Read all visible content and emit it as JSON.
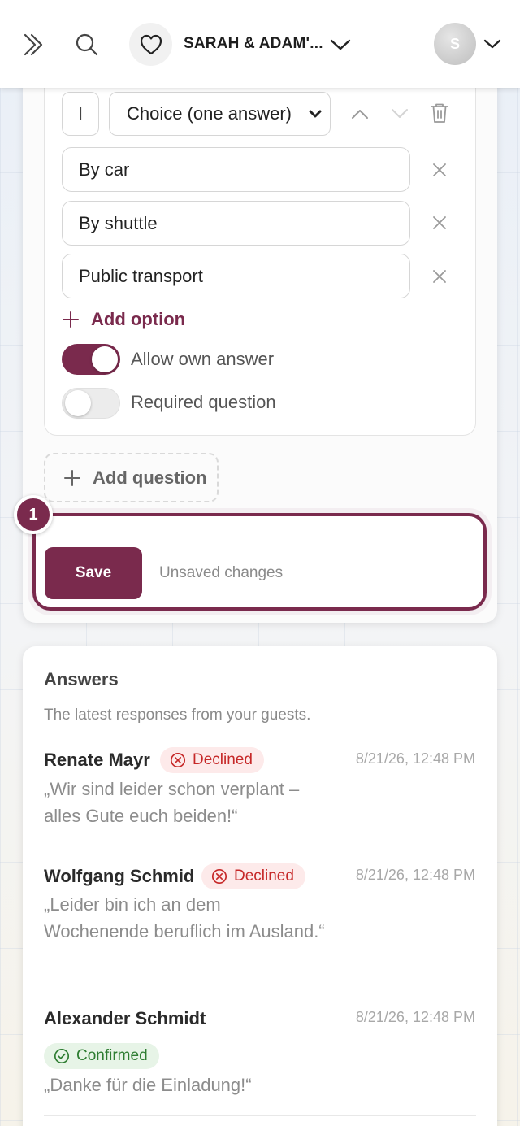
{
  "header": {
    "event_title": "SARAH & ADAM'...",
    "avatar_initial": "S"
  },
  "question": {
    "icon_value": "I",
    "type_value": "Choice (one answer)",
    "options": [
      "By car",
      "By shuttle",
      "Public transport"
    ],
    "add_option_label": "Add option",
    "allow_own_answer_label": "Allow own answer",
    "allow_own_answer": true,
    "required_label": "Required question",
    "required": false
  },
  "add_question_label": "Add question",
  "save": {
    "button_label": "Save",
    "status": "Unsaved changes",
    "step_number": "1"
  },
  "answers": {
    "title": "Answers",
    "subtitle": "The latest responses from your guests.",
    "responses": [
      {
        "name": "Renate Mayr",
        "status": "Declined",
        "time": "8/21/26, 12:48 PM",
        "message": "„Wir sind leider schon verplant – alles Gute euch beiden!“"
      },
      {
        "name": "Wolfgang Schmid",
        "status": "Declined",
        "time": "8/21/26, 12:48 PM",
        "message": "„Leider bin ich an dem Wochenende beruflich im Ausland.“"
      },
      {
        "name": "Alexander Schmidt",
        "status": "Confirmed",
        "time": "8/21/26, 12:48 PM",
        "message": "„Danke für die Einladung!“"
      }
    ]
  },
  "colors": {
    "accent": "#7a2a4d",
    "declined_text": "#c62828",
    "declined_bg": "#fdeaea",
    "confirmed_text": "#2e7d32",
    "confirmed_bg": "#e7f4e7"
  },
  "icons": [
    "double-chevron-right-icon",
    "search-icon",
    "heart-icon",
    "chevron-down-icon",
    "chevron-up-icon",
    "trash-icon",
    "close-icon",
    "plus-icon",
    "x-circle-icon",
    "check-circle-icon"
  ]
}
